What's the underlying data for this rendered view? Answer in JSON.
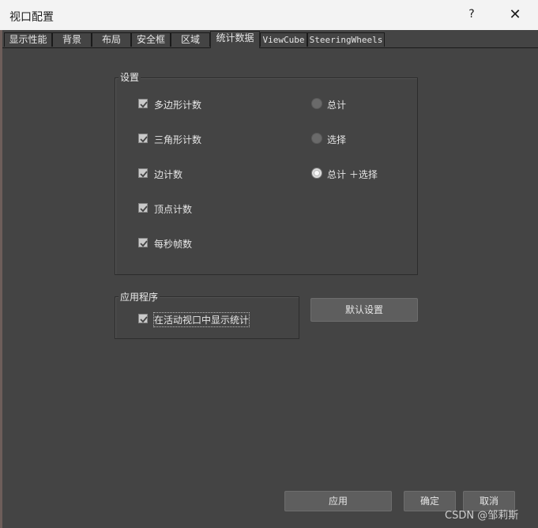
{
  "window": {
    "title": "视口配置",
    "help": "?",
    "close": "✕"
  },
  "tabs": [
    {
      "label": "显示性能",
      "active": false
    },
    {
      "label": "背景",
      "active": false
    },
    {
      "label": "布局",
      "active": false
    },
    {
      "label": "安全框",
      "active": false
    },
    {
      "label": "区域",
      "active": false
    },
    {
      "label": "统计数据",
      "active": true
    },
    {
      "label": "ViewCube",
      "active": false
    },
    {
      "label": "SteeringWheels",
      "active": false
    }
  ],
  "settings": {
    "label": "设置",
    "checkboxes": [
      {
        "label": "多边形计数",
        "checked": true
      },
      {
        "label": "三角形计数",
        "checked": true
      },
      {
        "label": "边计数",
        "checked": true
      },
      {
        "label": "顶点计数",
        "checked": true
      },
      {
        "label": "每秒帧数",
        "checked": true
      }
    ],
    "radios": [
      {
        "label": "总计",
        "selected": false
      },
      {
        "label": "选择",
        "selected": false
      },
      {
        "label": "总计 ＋选择",
        "selected": true
      }
    ]
  },
  "application": {
    "label": "应用程序",
    "checkbox": {
      "label": "在活动视口中显示统计",
      "checked": true
    }
  },
  "buttons": {
    "default_settings": "默认设置",
    "apply": "应用",
    "ok": "确定",
    "cancel": "取消"
  },
  "watermark": "CSDN @邹莉斯",
  "colors": {
    "panel": "#444444",
    "titlebar": "#f3f3f3",
    "button": "#5e5e5e"
  }
}
